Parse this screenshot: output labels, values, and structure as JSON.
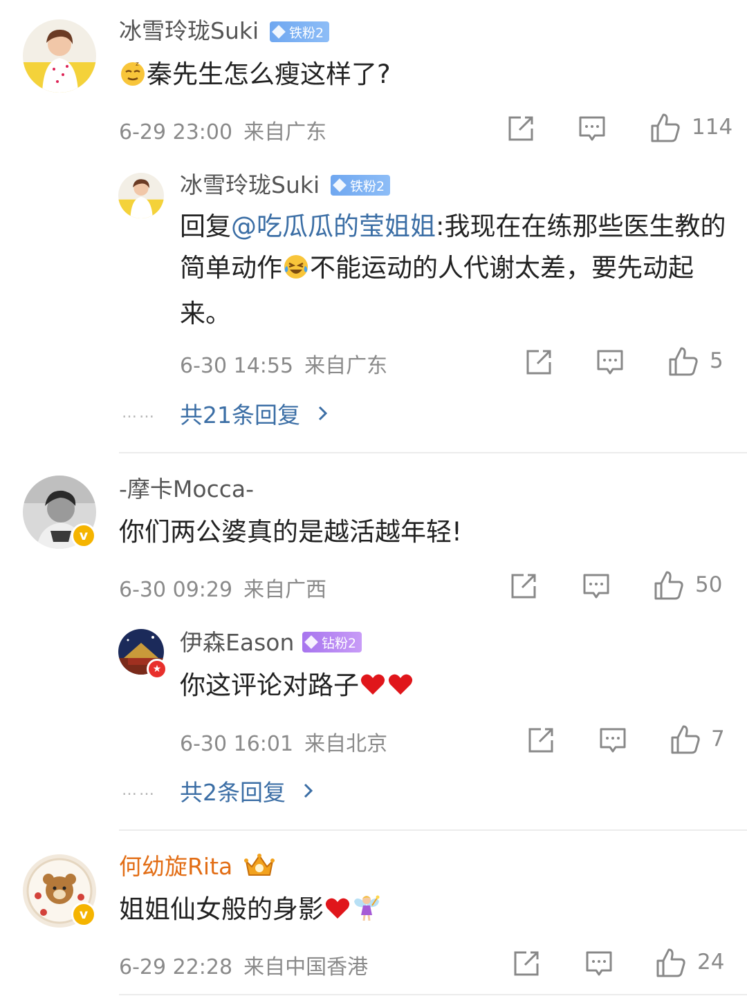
{
  "comments": [
    {
      "username": "冰雪玲珑Suki",
      "badge": "铁粉2",
      "text": "秦先生怎么瘦这样了?",
      "time": "6-29 23:00",
      "location": "来自广东",
      "likes": "114",
      "reply": {
        "username": "冰雪玲珑Suki",
        "badge": "铁粉2",
        "prefix": "回复",
        "mention": "@吃瓜瓜的莹姐姐",
        "text_a": ":我现在在练那些医生教的简单动作",
        "text_b": "不能运动的人代谢太差，要先动起来。",
        "time": "6-30 14:55",
        "location": "来自广东",
        "likes": "5"
      },
      "more_replies": "共21条回复"
    },
    {
      "username": "-摩卡Mocca-",
      "text": "你们两公婆真的是越活越年轻!",
      "time": "6-30 09:29",
      "location": "来自广西",
      "likes": "50",
      "reply": {
        "username": "伊森Eason",
        "badge": "钻粉2",
        "text": "你这评论对路子",
        "time": "6-30 16:01",
        "location": "来自北京",
        "likes": "7"
      },
      "more_replies": "共2条回复"
    },
    {
      "username": "何幼旋Rita",
      "text": "姐姐仙女般的身影",
      "time": "6-29 22:28",
      "location": "来自中国香港",
      "likes": "24"
    }
  ],
  "ellipsis": "……",
  "verified_mark": "v",
  "colors": {
    "link": "#3b6ea5",
    "gold_name": "#e26d15",
    "meta_gray": "#8a8a8a",
    "fan_blue": "#7fb2f4",
    "fan_purple": "#b584f2"
  },
  "icons": [
    "share-icon",
    "comment-icon",
    "like-thumb-icon",
    "chevron-right-icon"
  ]
}
